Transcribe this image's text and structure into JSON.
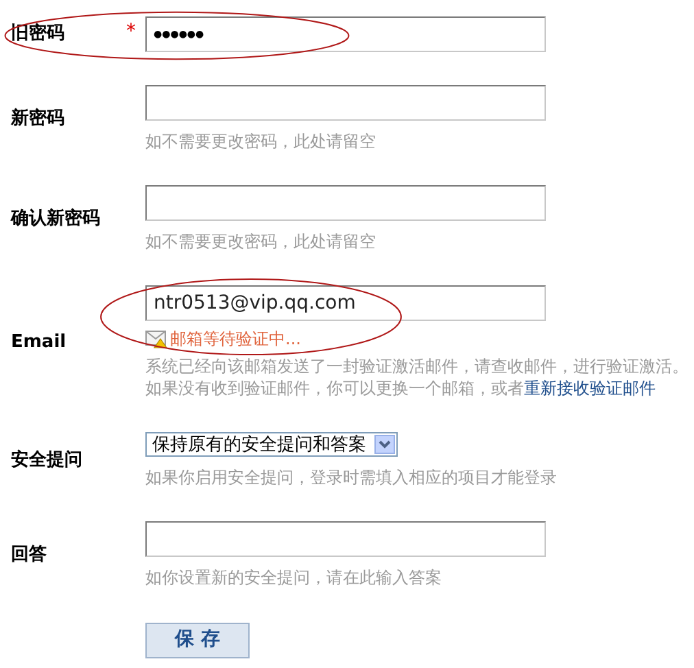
{
  "fields": [
    {
      "kind": "password",
      "label": "旧密码",
      "required_mark": "*",
      "value": "●●●●●●",
      "highlighted": true
    },
    {
      "kind": "password",
      "label": "新密码",
      "hint": "如不需要更改密码，此处请留空"
    },
    {
      "kind": "password",
      "label": "确认新密码",
      "hint": "如不需要更改密码，此处请留空"
    },
    {
      "kind": "email",
      "label": "Email",
      "value": "ntr0513@vip.qq.com",
      "status": "邮箱等待验证中...",
      "hint": "系统已经向该邮箱发送了一封验证激活邮件，请查收邮件，进行验证激活。如果没有收到验证邮件，你可以更换一个邮箱，或者",
      "link": "重新接收验证邮件",
      "highlighted": true
    },
    {
      "kind": "select",
      "label": "安全提问",
      "value": "保持原有的安全提问和答案",
      "hint": "如果你启用安全提问，登录时需填入相应的项目才能登录"
    },
    {
      "kind": "text",
      "label": "回答",
      "hint": "如你设置新的安全提问，请在此输入答案"
    }
  ],
  "submit": "保 存"
}
